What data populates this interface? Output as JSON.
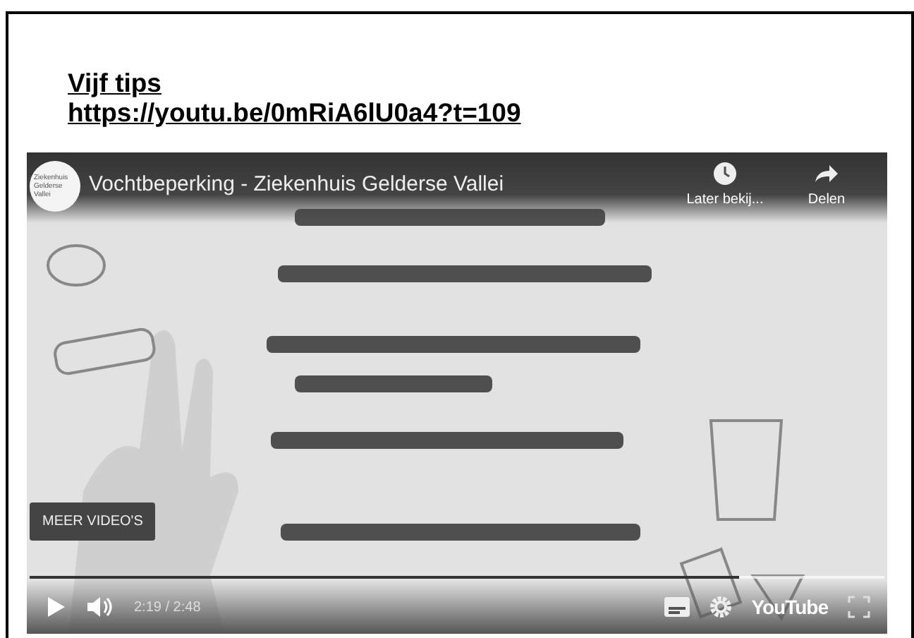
{
  "slide": {
    "title": "Vijf tips",
    "link": "https://youtu.be/0mRiA6lU0a4?t=109"
  },
  "video": {
    "kind": "picture",
    "channel_logo": [
      "Ziekenhuis",
      "Gelderse",
      "Vallei"
    ],
    "title": "Vochtbeperking - Ziekenhuis Gelderse Vallei",
    "actions": [
      {
        "kind": "clock",
        "label": "Later bekij..."
      },
      {
        "kind": "share",
        "label": "Delen"
      }
    ],
    "more_button": "MEER VIDEO'S",
    "progress": {
      "level": 0.83
    },
    "time": "2:19 / 2:48",
    "brand": "YouTube"
  }
}
